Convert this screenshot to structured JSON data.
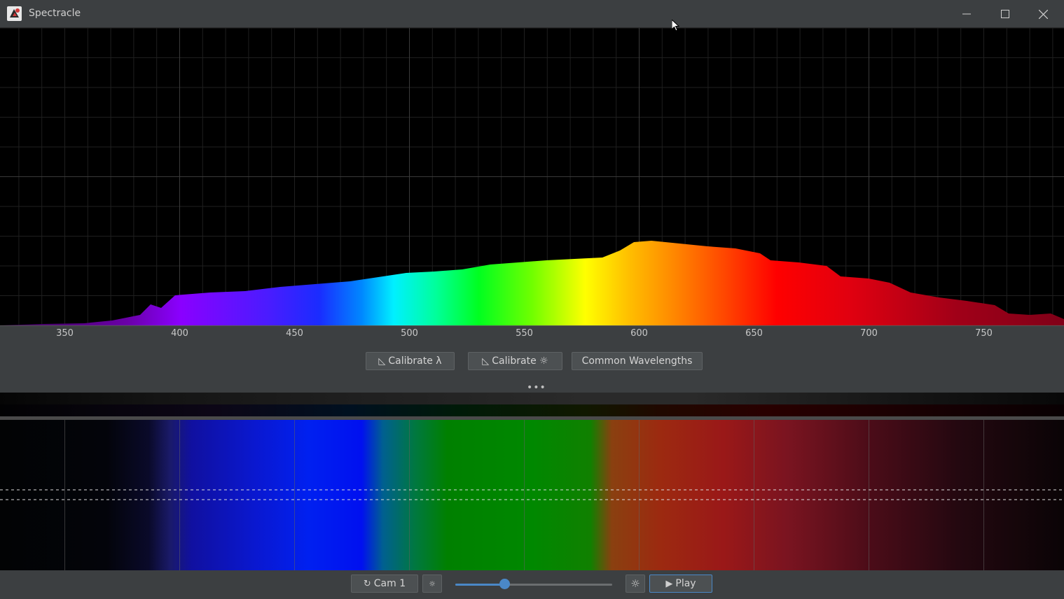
{
  "window": {
    "title": "Spectracle",
    "minimize_icon": "minimize-icon",
    "maximize_icon": "maximize-icon",
    "close_icon": "close-icon"
  },
  "spectrum_graph": {
    "x_axis_ticks": [
      "350",
      "400",
      "450",
      "500",
      "550",
      "600",
      "650",
      "700",
      "750"
    ]
  },
  "toolbar": {
    "calibrate_wavelength": {
      "icon": "ruler-icon",
      "label": "Calibrate λ"
    },
    "calibrate_intensity": {
      "icon": "ruler-icon",
      "label": "Calibrate ☼"
    },
    "common_wavelengths": {
      "label": "Common Wavelengths"
    },
    "more": "•••"
  },
  "bottom_bar": {
    "camera_button": {
      "icon": "refresh-icon",
      "label": "Cam 1"
    },
    "brightness_low_icon": "sun-small-icon",
    "exposure_slider": {
      "value": 0.32
    },
    "brightness_high_icon": "sun-large-icon",
    "play_button": {
      "icon": "play-icon",
      "label": "Play"
    }
  }
}
